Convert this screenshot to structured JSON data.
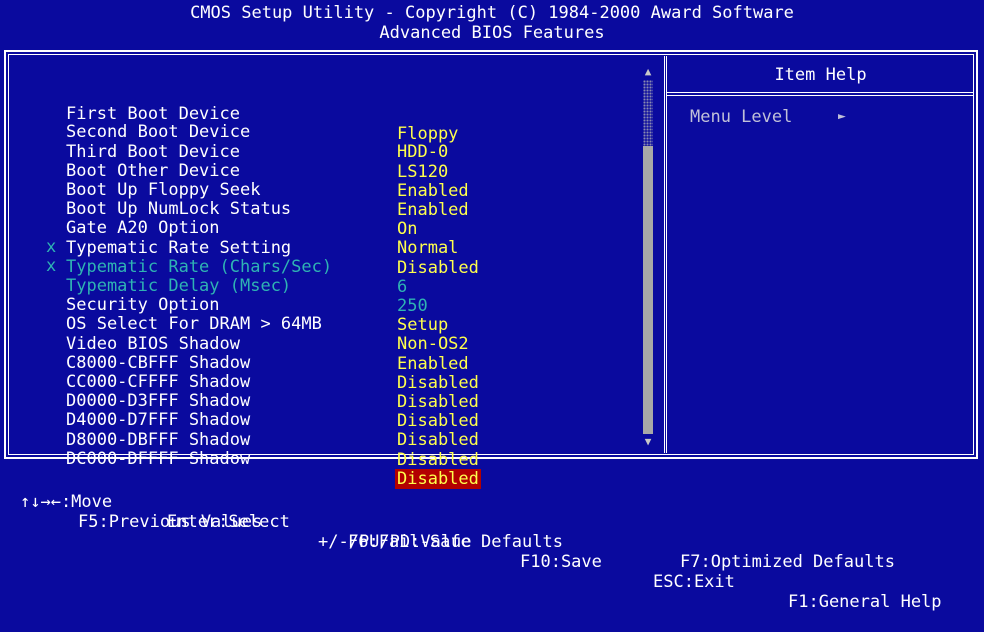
{
  "header": {
    "line1": "CMOS Setup Utility - Copyright (C) 1984-2000 Award Software",
    "line2": "Advanced BIOS Features"
  },
  "settings": [
    {
      "mark": "",
      "label": "First Boot Device",
      "value": "Floppy"
    },
    {
      "mark": "",
      "label": "Second Boot Device",
      "value": "HDD-0"
    },
    {
      "mark": "",
      "label": "Third Boot Device",
      "value": "LS120"
    },
    {
      "mark": "",
      "label": "Boot Other Device",
      "value": "Enabled"
    },
    {
      "mark": "",
      "label": "Boot Up Floppy Seek",
      "value": "Enabled"
    },
    {
      "mark": "",
      "label": "Boot Up NumLock Status",
      "value": "On"
    },
    {
      "mark": "",
      "label": "Gate A20 Option",
      "value": "Normal"
    },
    {
      "mark": "",
      "label": "Typematic Rate Setting",
      "value": "Disabled"
    },
    {
      "mark": "x",
      "label": "Typematic Rate (Chars/Sec)",
      "value": "6"
    },
    {
      "mark": "x",
      "label": "Typematic Delay (Msec)",
      "value": "250"
    },
    {
      "mark": "",
      "label": "Security Option",
      "value": "Setup"
    },
    {
      "mark": "",
      "label": "OS Select For DRAM > 64MB",
      "value": "Non-OS2"
    },
    {
      "mark": "",
      "label": "Video BIOS Shadow",
      "value": "Enabled"
    },
    {
      "mark": "",
      "label": "C8000-CBFFF Shadow",
      "value": "Disabled"
    },
    {
      "mark": "",
      "label": "CC000-CFFFF Shadow",
      "value": "Disabled"
    },
    {
      "mark": "",
      "label": "D0000-D3FFF Shadow",
      "value": "Disabled"
    },
    {
      "mark": "",
      "label": "D4000-D7FFF Shadow",
      "value": "Disabled"
    },
    {
      "mark": "",
      "label": "D8000-DBFFF Shadow",
      "value": "Disabled"
    },
    {
      "mark": "",
      "label": "DC000-DFFFF Shadow",
      "value": "Disabled"
    }
  ],
  "help": {
    "title": "Item Help",
    "menu_level": "Menu Level",
    "menu_level_icon": "triangle-right-icon"
  },
  "footer": {
    "move": "↑↓→←:Move",
    "select": "Enter:Select",
    "value": "+/-/PU/PD:Value",
    "save": "F10:Save",
    "exit": "ESC:Exit",
    "general_help": "F1:General Help",
    "previous": "F5:Previous Values",
    "failsafe": "F6:Fail-Safe Defaults",
    "optimized": "F7:Optimized Defaults"
  },
  "colors": {
    "background": "#0a0a9e",
    "value_text": "#ffff4c",
    "disabled_text": "#2fb3b3",
    "selection": "#b30000"
  }
}
